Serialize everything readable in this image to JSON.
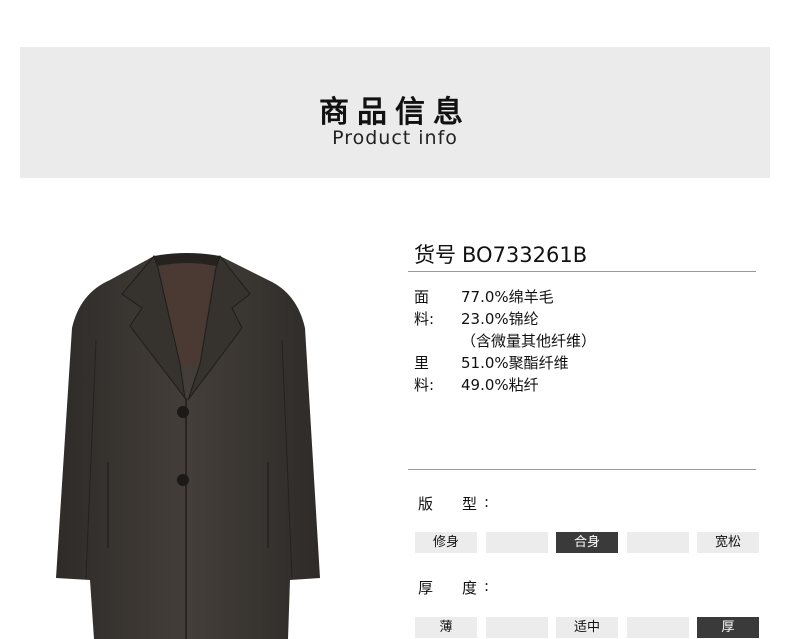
{
  "header": {
    "title": "商品信息",
    "subtitle": "Product info"
  },
  "product": {
    "sku_label": "货号",
    "sku_value": "BO733261B",
    "shell_label": "面料:",
    "shell": [
      "77.0%绵羊毛",
      "23.0%锦纶",
      "（含微量其他纤维）"
    ],
    "lining_label": "里料:",
    "lining": [
      "51.0%聚酯纤维",
      "49.0%粘纤"
    ]
  },
  "fit": {
    "label_char1": "版",
    "label_char2": "型",
    "colon": ":",
    "options": [
      "修身",
      "",
      "合身",
      "",
      "宽松"
    ],
    "selected_index": 2
  },
  "thickness": {
    "label_char1": "厚",
    "label_char2": "度",
    "colon": ":",
    "options": [
      "薄",
      "",
      "适中",
      "",
      "厚"
    ],
    "selected_index": 4
  },
  "colors": {
    "banner_bg": "#ebebeb",
    "segment_off": "#ececec",
    "segment_on": "#3a3a3a",
    "coat": "#3b3733"
  }
}
